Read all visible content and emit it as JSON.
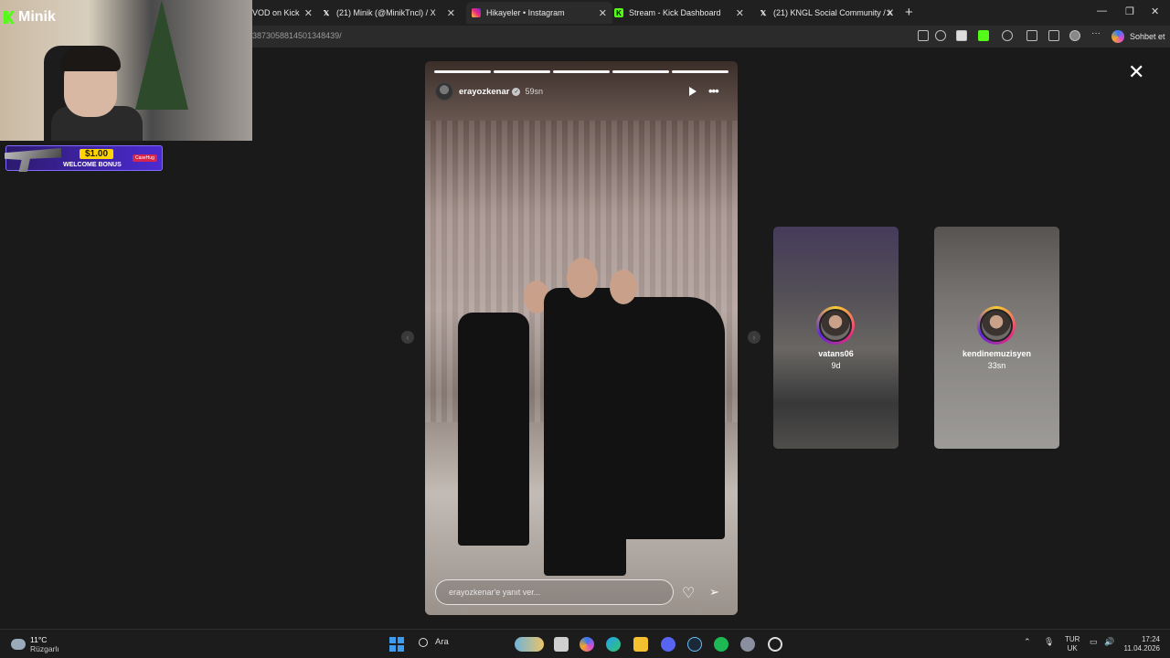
{
  "browser": {
    "tabs": [
      {
        "title": "VOD on Kick",
        "icon": "kick-icon"
      },
      {
        "title": "(21) Minik (@MinikTncl) / X",
        "icon": "x-icon"
      },
      {
        "title": "Hikayeler • Instagram",
        "icon": "instagram-icon",
        "active": true
      },
      {
        "title": "Stream - Kick Dashboard",
        "icon": "kick-icon"
      },
      {
        "title": "(21) KNGL Social Community / X",
        "icon": "x-icon"
      }
    ],
    "url": "3873058814501348439/",
    "copilot_label": "Sohbet et"
  },
  "overlay": {
    "brand": "Minik",
    "promo_amount": "$1.00",
    "promo_text": "WELCOME BONUS",
    "promo_logo": "CaseHug"
  },
  "story": {
    "username": "erayozkenar",
    "time_ago": "59sn",
    "segments": 5,
    "current_segment": 5,
    "reply_placeholder": "erayozkenar'e yanıt ver..."
  },
  "next_stories": [
    {
      "username": "vatans06",
      "time_ago": "9d"
    },
    {
      "username": "kendinemuzisyen",
      "time_ago": "33sn"
    }
  ],
  "taskbar": {
    "temperature": "11°C",
    "condition": "Rüzgarlı",
    "search_label": "Ara",
    "lang_top": "TUR",
    "lang_bottom": "UK",
    "time": "17:24",
    "date": "11.04.2026"
  }
}
